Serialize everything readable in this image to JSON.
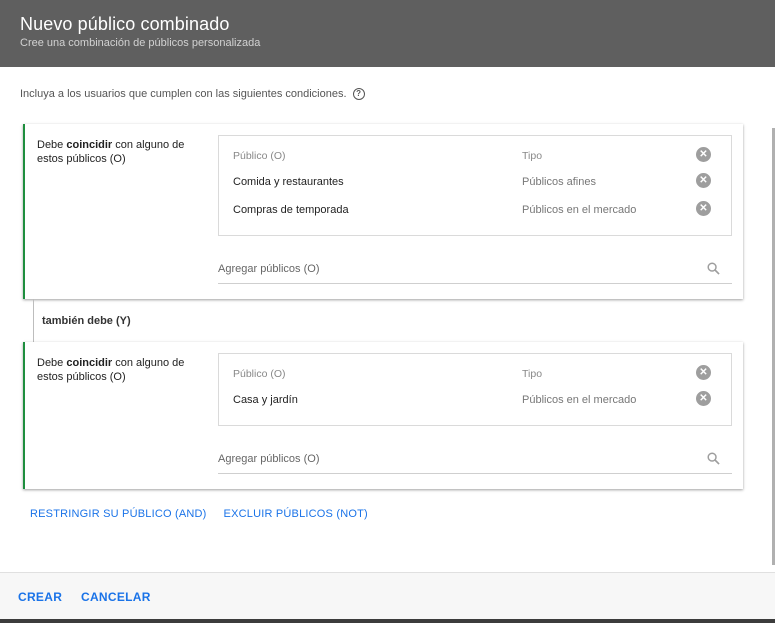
{
  "dialog": {
    "title": "Nuevo público combinado",
    "subtitle": "Cree una combinación de públicos personalizada"
  },
  "intro": "Incluya a los usuarios que cumplen con las siguientes condiciones.",
  "help_icon": "?",
  "groups": [
    {
      "label_before": "Debe ",
      "label_bold": "coincidir",
      "label_after": " con alguno de estos públicos (O)",
      "columns": {
        "name": "Público (O)",
        "type": "Tipo"
      },
      "rows": [
        {
          "name": "Comida y restaurantes",
          "type": "Públicos afines"
        },
        {
          "name": "Compras de temporada",
          "type": "Públicos en el mercado"
        }
      ],
      "add_placeholder": "Agregar públicos (O)"
    },
    {
      "label_before": "Debe ",
      "label_bold": "coincidir",
      "label_after": " con alguno de estos públicos (O)",
      "columns": {
        "name": "Público (O)",
        "type": "Tipo"
      },
      "rows": [
        {
          "name": "Casa y jardín",
          "type": "Públicos en el mercado"
        }
      ],
      "add_placeholder": "Agregar públicos (O)"
    }
  ],
  "connector_label": "también debe (Y)",
  "links": {
    "restrict": "RESTRINGIR SU PÚBLICO (AND)",
    "exclude": "EXCLUIR PÚBLICOS (NOT)"
  },
  "footer": {
    "create": "CREAR",
    "cancel": "CANCELAR"
  },
  "icons": {
    "clear": "clear-circle-icon",
    "search": "search-icon",
    "help": "help-circle-icon"
  },
  "colors": {
    "header_bg": "#5f5f5f",
    "accent_green": "#1e8e3e",
    "link_blue": "#1a73e8"
  }
}
